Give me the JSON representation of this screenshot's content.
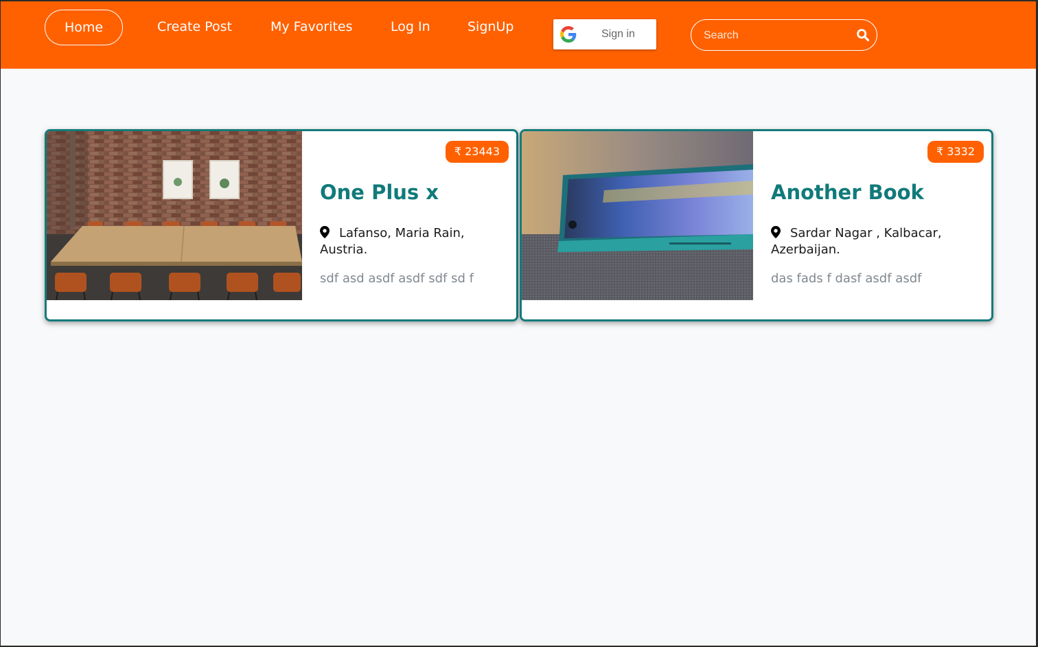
{
  "navbar": {
    "links": {
      "home": "Home",
      "create_post": "Create Post",
      "my_favorites": "My Favorites",
      "log_in": "Log In",
      "signup": "SignUp"
    },
    "google_signin_label": "Sign in",
    "search": {
      "placeholder": "Search",
      "value": ""
    }
  },
  "colors": {
    "brand": "#ff6100",
    "card_border": "#147a7a",
    "title": "#117a7a",
    "description": "#808890"
  },
  "cards": [
    {
      "price": "₹ 23443",
      "title": "One Plus x",
      "location": "Lafanso, Maria Rain, Austria.",
      "description": "sdf asd asdf asdf sdf sd f",
      "image": "conference-room-photo"
    },
    {
      "price": "₹ 3332",
      "title": "Another Book",
      "location": "Sardar Nagar , Kalbacar, Azerbaijan.",
      "description": "das fads f dasf asdf asdf",
      "image": "smartphone-photo"
    }
  ]
}
